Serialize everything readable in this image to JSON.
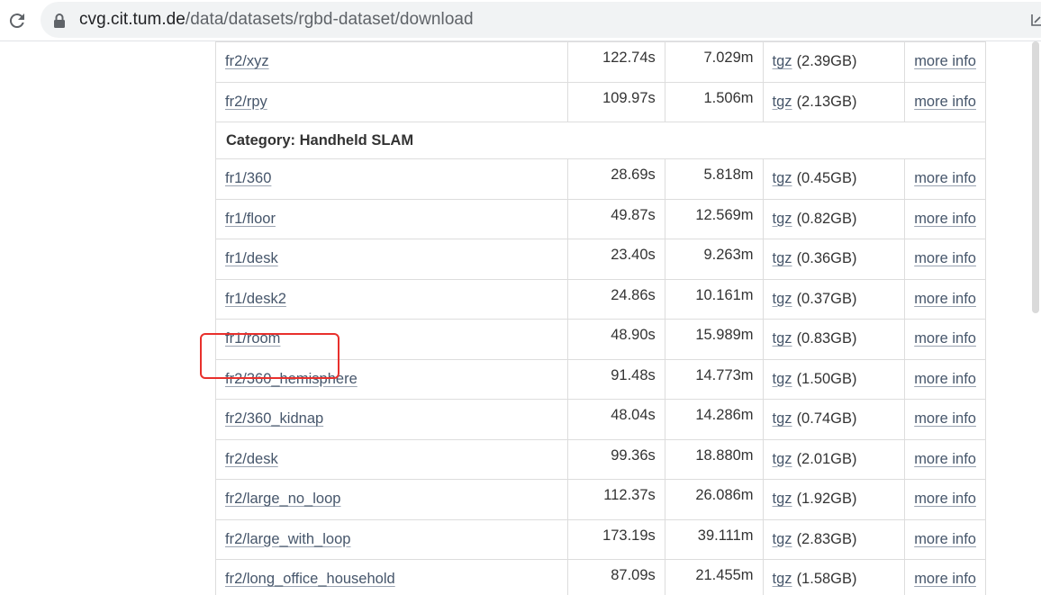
{
  "browser": {
    "url_host": "cvg.cit.tum.de",
    "url_path": "/data/datasets/rgbd-dataset/download",
    "icons": [
      "reload-icon",
      "lock-icon",
      "share-icon"
    ]
  },
  "table": {
    "rows_before": [
      {
        "name": "fr2/xyz",
        "duration": "122.74s",
        "length": "7.029m",
        "download": "tgz",
        "size": "(2.39GB)",
        "info": "more info"
      },
      {
        "name": "fr2/rpy",
        "duration": "109.97s",
        "length": "1.506m",
        "download": "tgz",
        "size": "(2.13GB)",
        "info": "more info"
      }
    ],
    "category": "Category: Handheld SLAM",
    "rows": [
      {
        "name": "fr1/360",
        "duration": "28.69s",
        "length": "5.818m",
        "download": "tgz",
        "size": "(0.45GB)",
        "info": "more info"
      },
      {
        "name": "fr1/floor",
        "duration": "49.87s",
        "length": "12.569m",
        "download": "tgz",
        "size": "(0.82GB)",
        "info": "more info"
      },
      {
        "name": "fr1/desk",
        "duration": "23.40s",
        "length": "9.263m",
        "download": "tgz",
        "size": "(0.36GB)",
        "info": "more info"
      },
      {
        "name": "fr1/desk2",
        "duration": "24.86s",
        "length": "10.161m",
        "download": "tgz",
        "size": "(0.37GB)",
        "info": "more info"
      },
      {
        "name": "fr1/room",
        "duration": "48.90s",
        "length": "15.989m",
        "download": "tgz",
        "size": "(0.83GB)",
        "info": "more info"
      },
      {
        "name": "fr2/360_hemisphere",
        "duration": "91.48s",
        "length": "14.773m",
        "download": "tgz",
        "size": "(1.50GB)",
        "info": "more info"
      },
      {
        "name": "fr2/360_kidnap",
        "duration": "48.04s",
        "length": "14.286m",
        "download": "tgz",
        "size": "(0.74GB)",
        "info": "more info"
      },
      {
        "name": "fr2/desk",
        "duration": "99.36s",
        "length": "18.880m",
        "download": "tgz",
        "size": "(2.01GB)",
        "info": "more info"
      },
      {
        "name": "fr2/large_no_loop",
        "duration": "112.37s",
        "length": "26.086m",
        "download": "tgz",
        "size": "(1.92GB)",
        "info": "more info"
      },
      {
        "name": "fr2/large_with_loop",
        "duration": "173.19s",
        "length": "39.111m",
        "download": "tgz",
        "size": "(2.83GB)",
        "info": "more info"
      },
      {
        "name": "fr2/long_office_household",
        "duration": "87.09s",
        "length": "21.455m",
        "download": "tgz",
        "size": "(1.58GB)",
        "info": "more info"
      }
    ]
  },
  "colors": {
    "link": "#46566b",
    "highlight": "#e8302c",
    "border": "#dddddd"
  }
}
